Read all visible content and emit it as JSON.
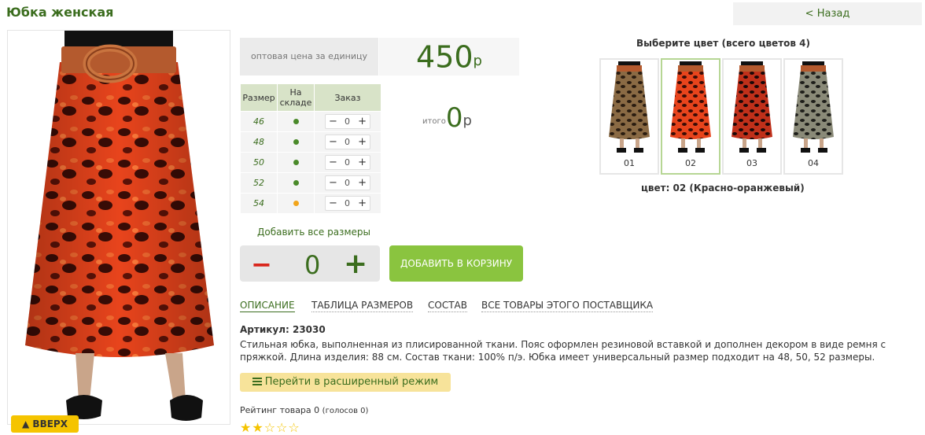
{
  "header": {
    "title": "Юбка женская",
    "back_label": "< Назад",
    "top_label": "▲ ВВЕРХ"
  },
  "price": {
    "label": "оптовая цена за единицу",
    "value": "450",
    "currency": "р"
  },
  "sizes_table": {
    "headers": [
      "Размер",
      "На складе",
      "Заказ"
    ],
    "rows": [
      {
        "size": "46",
        "stock_color": "#4a8a2a",
        "qty": "0"
      },
      {
        "size": "48",
        "stock_color": "#4a8a2a",
        "qty": "0"
      },
      {
        "size": "50",
        "stock_color": "#4a8a2a",
        "qty": "0"
      },
      {
        "size": "52",
        "stock_color": "#4a8a2a",
        "qty": "0"
      },
      {
        "size": "54",
        "stock_color": "#f2a51b",
        "qty": "0"
      }
    ],
    "minus": "−",
    "plus": "+"
  },
  "total": {
    "label": "итого",
    "value": "0",
    "currency": "р"
  },
  "add_all_sizes": "Добавить все размеры",
  "quantity": {
    "minus": "−",
    "value": "0",
    "plus": "+"
  },
  "add_to_cart": "ДОБАВИТЬ В КОРЗИНУ",
  "tabs": [
    {
      "label": "ОПИСАНИЕ",
      "active": true
    },
    {
      "label": "ТАБЛИЦА РАЗМЕРОВ",
      "active": false
    },
    {
      "label": "СОСТАВ",
      "active": false
    },
    {
      "label": "ВСЕ ТОВАРЫ ЭТОГО ПОСТАВЩИКА",
      "active": false
    }
  ],
  "article": "Артикул: 23030",
  "description": "Стильная юбка, выполненная из плисированной ткани. Пояс оформлен резиновой вставкой и дополнен декором в виде ремня с пряжкой. Длина изделия: 88 см. Состав ткани: 100% п/э. Юбка имеет универсальный размер подходит на 48, 50, 52 размеры.",
  "advanced_mode": "Перейти в расширенный режим",
  "rating": {
    "label": "Рейтинг товара",
    "value": "0",
    "votes": "(голосов 0)",
    "stars": "★★☆☆☆"
  },
  "colors": {
    "title": "Выберите цвет (всего цветов 4)",
    "selected_text": "цвет: 02 (Красно-оранжевый)",
    "items": [
      {
        "num": "01",
        "base": "#8a6a44",
        "spot": "#2a1c10"
      },
      {
        "num": "02",
        "base": "#e8441c",
        "spot": "#3a0c06"
      },
      {
        "num": "03",
        "base": "#c0301a",
        "spot": "#1a0808"
      },
      {
        "num": "04",
        "base": "#8a8a78",
        "spot": "#1e1e1a"
      }
    ]
  },
  "theme": {
    "green": "#3b6d1e",
    "cart_green": "#8ac43f",
    "yellow": "#f5c400"
  }
}
